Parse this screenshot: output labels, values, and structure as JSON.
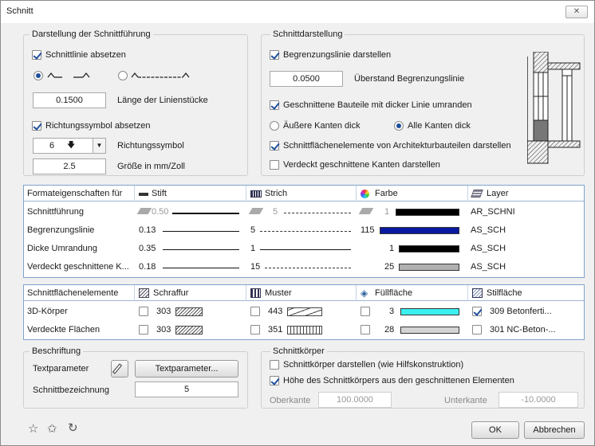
{
  "window": {
    "title": "Schnitt",
    "close": "✕"
  },
  "darstellung": {
    "legend": "Darstellung der Schnittführung",
    "schnittlinie_label": "Schnittlinie absetzen",
    "linienstuecke_value": "0.1500",
    "linienstuecke_label": "Länge der Linienstücke",
    "richtungssymbol_absetzen_label": "Richtungssymbol absetzen",
    "richtungssymbol_value": "6",
    "richtungssymbol_label": "Richtungssymbol",
    "groesse_value": "2.5",
    "groesse_label": "Größe in mm/Zoll"
  },
  "schnittdarstellung": {
    "legend": "Schnittdarstellung",
    "begrenzung_label": "Begrenzungslinie darstellen",
    "ueberstand_value": "0.0500",
    "ueberstand_label": "Überstand Begrenzungslinie",
    "dicke_linie_label": "Geschnittene Bauteile mit dicker Linie umranden",
    "aeussere_label": "Äußere Kanten dick",
    "alle_label": "Alle Kanten dick",
    "schnittflaechen_label": "Schnittflächenelemente von Architekturbauteilen darstellen",
    "verdeckt_label": "Verdeckt geschnittene Kanten darstellen"
  },
  "format_table": {
    "headers": [
      "Formateigenschaften für",
      "Stift",
      "Strich",
      "Farbe",
      "Layer"
    ],
    "rows": [
      {
        "name": "Schnittführung",
        "stift": "0.50",
        "strich": "5",
        "farbe": "1",
        "color": "#000000",
        "layer": "AR_SCHNI"
      },
      {
        "name": "Begrenzungslinie",
        "stift": "0.13",
        "strich": "5",
        "farbe": "115",
        "color": "#0a1aa0",
        "layer": "AS_SCH"
      },
      {
        "name": "Dicke Umrandung",
        "stift": "0.35",
        "strich": "1",
        "farbe": "1",
        "color": "#000000",
        "layer": "AS_SCH"
      },
      {
        "name": "Verdeckt geschnittene K...",
        "stift": "0.18",
        "strich": "15",
        "farbe": "25",
        "color": "#b0b0b0",
        "layer": "AS_SCH"
      }
    ]
  },
  "flaechen_table": {
    "headers": [
      "Schnittflächenelemente",
      "Schraffur",
      "Muster",
      "Füllfläche",
      "Stilfläche"
    ],
    "rows": [
      {
        "name": "3D-Körper",
        "schraffur": "303",
        "muster": "443",
        "fuell": "3",
        "fuell_color": "#3cf0f0",
        "stil": "309 Betonferti..."
      },
      {
        "name": "Verdeckte Flächen",
        "schraffur": "303",
        "muster": "351",
        "fuell": "28",
        "fuell_color": "#d4d4d4",
        "stil": "301 NC-Beton-..."
      }
    ]
  },
  "beschriftung": {
    "legend": "Beschriftung",
    "textparameter_label": "Textparameter",
    "textparameter_button": "Textparameter...",
    "schnittbez_label": "Schnittbezeichnung",
    "schnittbez_value": "5"
  },
  "schnittkoerper": {
    "legend": "Schnittkörper",
    "darstellen_label": "Schnittkörper darstellen (wie Hilfskonstruktion)",
    "hoehe_label": "Höhe des Schnittkörpers aus den geschnittenen Elementen",
    "oberkante_label": "Oberkante",
    "oberkante_value": "100.0000",
    "unterkante_label": "Unterkante",
    "unterkante_value": "-10.0000"
  },
  "footer": {
    "ok": "OK",
    "cancel": "Abbrechen"
  }
}
